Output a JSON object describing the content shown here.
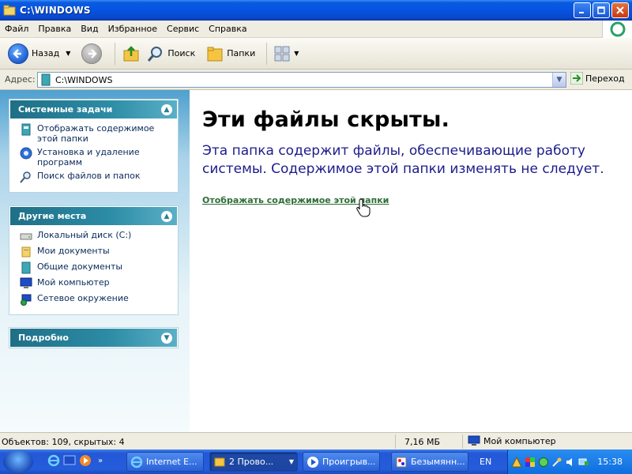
{
  "window": {
    "title": "C:\\WINDOWS",
    "controls": {
      "minimize": "_",
      "maximize": "□",
      "close": "×"
    }
  },
  "menu": [
    "Файл",
    "Правка",
    "Вид",
    "Избранное",
    "Сервис",
    "Справка"
  ],
  "toolbar": {
    "back_label": "Назад",
    "search_label": "Поиск",
    "folders_label": "Папки"
  },
  "address": {
    "label": "Адрес:",
    "value": "C:\\WINDOWS",
    "go_label": "Переход"
  },
  "sidebar": {
    "system_tasks": {
      "title": "Системные задачи",
      "items": [
        {
          "label": "Отображать содержимое этой папки",
          "icon": "folder-view-icon"
        },
        {
          "label": "Установка и удаление программ",
          "icon": "install-programs-icon"
        },
        {
          "label": "Поиск файлов и папок",
          "icon": "search-icon"
        }
      ]
    },
    "other_places": {
      "title": "Другие места",
      "items": [
        {
          "label": "Локальный диск (C:)",
          "icon": "drive-icon"
        },
        {
          "label": "Мои документы",
          "icon": "my-documents-icon"
        },
        {
          "label": "Общие документы",
          "icon": "shared-documents-icon"
        },
        {
          "label": "Мой компьютер",
          "icon": "my-computer-icon"
        },
        {
          "label": "Сетевое окружение",
          "icon": "network-icon"
        }
      ]
    },
    "details": {
      "title": "Подробно"
    }
  },
  "main": {
    "heading": "Эти файлы скрыты.",
    "message": "Эта папка содержит файлы, обеспечивающие работу системы. Содержимое этой папки изменять не следует.",
    "link": "Отображать содержимое этой папки"
  },
  "status": {
    "objects": "Объектов: 109, скрытых: 4",
    "size": "7,16 МБ",
    "location": "Мой компьютер"
  },
  "taskbar": {
    "buttons": [
      {
        "label": "Internet E...",
        "active": false
      },
      {
        "label": "2 Прово...",
        "active": true
      },
      {
        "label": "Проигрыв...",
        "active": false
      },
      {
        "label": "Безымянн...",
        "active": false
      }
    ],
    "language": "EN",
    "clock": "15:38"
  },
  "colors": {
    "title_bar": "#0554e3",
    "panel_header": "#2d8ca6",
    "link": "#2e6e39",
    "message": "#1c1c8c"
  }
}
